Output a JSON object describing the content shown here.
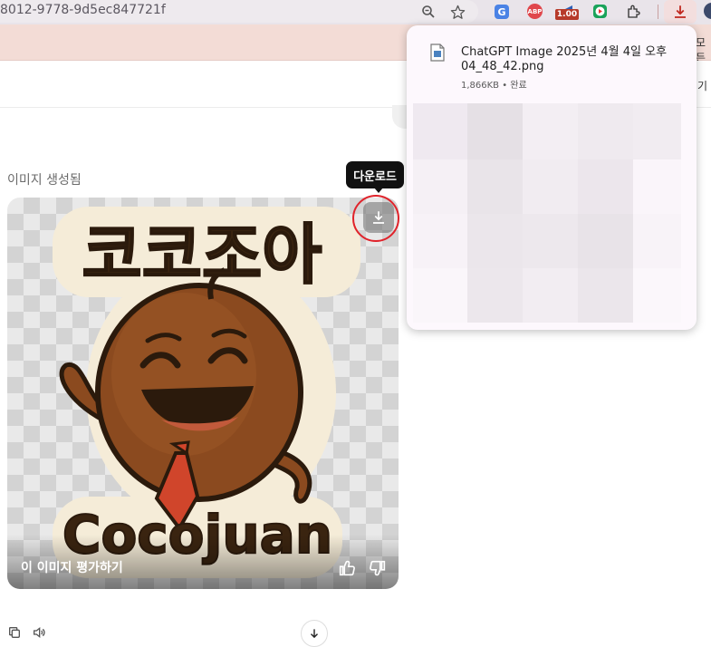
{
  "browser": {
    "url_fragment": "8012-9778-9d5ec847721f",
    "extension_badge": "1.00",
    "bookmark_overflow_text": "모든",
    "translate_ext_label": "G",
    "abp_ext_label": "ABP"
  },
  "download_popup": {
    "filename_line1": "ChatGPT Image 2025년 4월 4일 오후",
    "filename_line2": "04_48_42.png",
    "status": "1,866KB • 완료",
    "edge_text": "기"
  },
  "chat": {
    "generated_label": "이미지 생성됨",
    "download_tooltip": "다운로드",
    "rate_label": "이 이미지 평가하기"
  },
  "image": {
    "title_korean": "코코조아",
    "title_english": "Cocojuan"
  },
  "colors": {
    "accent_red": "#e0232b",
    "coconut_brown": "#8b4a1f",
    "tie_red": "#d0452b",
    "chrome_background": "#e9e4ea",
    "bookmark_bar": "#f3dcd6"
  },
  "icons": [
    "zoom-icon",
    "star-icon",
    "translate-icon",
    "abp-icon",
    "extension-badge-icon",
    "youtube-icon",
    "puzzle-icon",
    "download-icon",
    "profile-avatar",
    "file-icon",
    "thumbs-up-icon",
    "thumbs-down-icon",
    "copy-icon",
    "speaker-icon",
    "arrow-down-icon"
  ]
}
